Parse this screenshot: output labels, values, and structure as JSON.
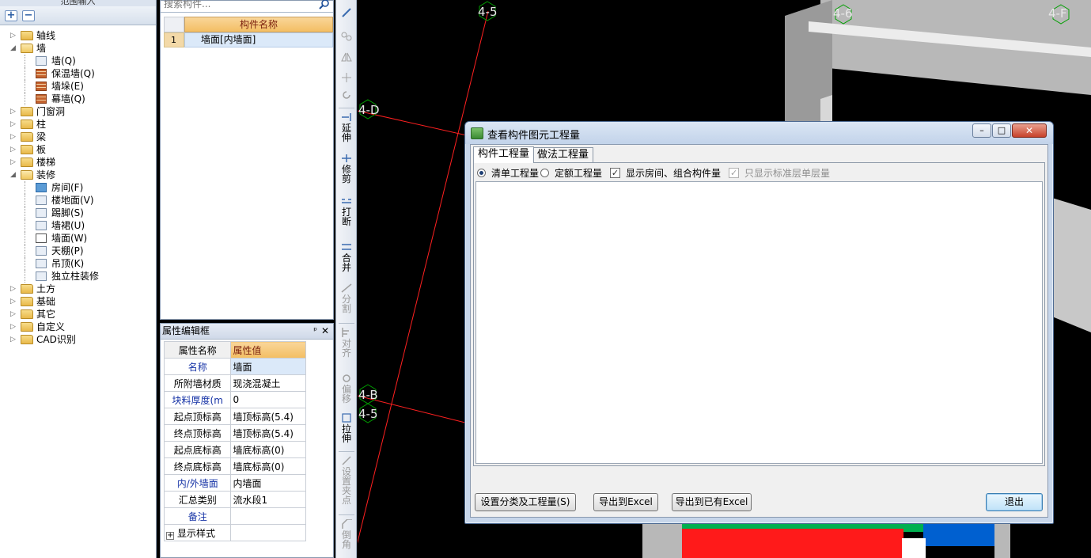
{
  "nav": {
    "title": "范围输入",
    "toolbar": {
      "expand_label": "+",
      "collapse_label": "−"
    },
    "tree": [
      {
        "label": "轴线",
        "level": 0,
        "expanded": false
      },
      {
        "label": "墙",
        "level": 0,
        "expanded": true
      },
      {
        "label": "墙(Q)",
        "level": 1
      },
      {
        "label": "保温墙(Q)",
        "level": 1
      },
      {
        "label": "墙垛(E)",
        "level": 1
      },
      {
        "label": "幕墙(Q)",
        "level": 1
      },
      {
        "label": "门窗洞",
        "level": 0,
        "expanded": false
      },
      {
        "label": "柱",
        "level": 0,
        "expanded": false
      },
      {
        "label": "梁",
        "level": 0,
        "expanded": false
      },
      {
        "label": "板",
        "level": 0,
        "expanded": false
      },
      {
        "label": "楼梯",
        "level": 0,
        "expanded": false
      },
      {
        "label": "装修",
        "level": 0,
        "expanded": true
      },
      {
        "label": "房间(F)",
        "level": 1
      },
      {
        "label": "楼地面(V)",
        "level": 1
      },
      {
        "label": "踢脚(S)",
        "level": 1
      },
      {
        "label": "墙裙(U)",
        "level": 1
      },
      {
        "label": "墙面(W)",
        "level": 1
      },
      {
        "label": "天棚(P)",
        "level": 1
      },
      {
        "label": "吊顶(K)",
        "level": 1
      },
      {
        "label": "独立柱装修",
        "level": 1
      },
      {
        "label": "土方",
        "level": 0,
        "expanded": false
      },
      {
        "label": "基础",
        "level": 0,
        "expanded": false
      },
      {
        "label": "其它",
        "level": 0,
        "expanded": false
      },
      {
        "label": "自定义",
        "level": 0,
        "expanded": false
      },
      {
        "label": "CAD识别",
        "level": 0,
        "expanded": false
      }
    ]
  },
  "component_panel": {
    "search_placeholder": "搜索构件...",
    "column_header": "构件名称",
    "rows": [
      {
        "index": "1",
        "name": "墙面[内墙面]"
      }
    ]
  },
  "property_panel": {
    "title": "属性编辑框",
    "pin_glyph": "ᵖ",
    "close_glyph": "✕",
    "header": {
      "name": "属性名称",
      "value": "属性值"
    },
    "rows": [
      {
        "name": "名称",
        "value": "墙面"
      },
      {
        "name": "所附墙材质",
        "value": "现浇混凝土"
      },
      {
        "name": "块料厚度(m",
        "value": "0"
      },
      {
        "name": "起点顶标高",
        "value": "墙顶标高(5.4)"
      },
      {
        "name": "终点顶标高",
        "value": "墙顶标高(5.4)"
      },
      {
        "name": "起点底标高",
        "value": "墙底标高(0)"
      },
      {
        "name": "终点底标高",
        "value": "墙底标高(0)"
      },
      {
        "name": "内/外墙面",
        "value": "内墙面"
      },
      {
        "name": "汇总类别",
        "value": "流水段1"
      },
      {
        "name": "备注",
        "value": ""
      },
      {
        "name": "显示样式",
        "value": ""
      }
    ],
    "expand_glyph": "+"
  },
  "vertical_toolbar": {
    "items": [
      {
        "label": "延伸",
        "enabled": true
      },
      {
        "label": "修剪",
        "enabled": true
      },
      {
        "label": "打断",
        "enabled": true
      },
      {
        "label": "合并",
        "enabled": true
      },
      {
        "label": "分割",
        "enabled": false
      },
      {
        "label": "对齐",
        "enabled": false
      },
      {
        "label": "偏移",
        "enabled": false
      },
      {
        "label": "拉伸",
        "enabled": true
      },
      {
        "label": "设置夹点",
        "enabled": false
      },
      {
        "label": "倒角",
        "enabled": false
      }
    ]
  },
  "canvas": {
    "axis_labels": [
      "4-5",
      "4-6",
      "4-F",
      "4-D",
      "4-B",
      "4-5"
    ],
    "colors": {
      "axis_line": "#ff2020",
      "wall": "#b4b4b4",
      "floor_red": "#ff1a1a",
      "floor_green": "#00b050",
      "floor_blue": "#0060d0",
      "marker": "#00a000"
    }
  },
  "dialog": {
    "title": "查看构件图元工程量",
    "window_buttons": {
      "minimize": "–",
      "maximize": "□",
      "close": "✕"
    },
    "tabs": [
      {
        "label": "构件工程量",
        "active": true
      },
      {
        "label": "做法工程量",
        "active": false
      }
    ],
    "options": {
      "radio_list": "清单工程量",
      "radio_quota": "定额工程量",
      "check_room": "显示房间、组合构件量",
      "check_standard": "只显示标准层单层量",
      "check_glyph": "✓"
    },
    "buttons": {
      "set_category": "设置分类及工程量(S)",
      "export_excel": "导出到Excel",
      "export_existing_excel": "导出到已有Excel",
      "exit": "退出"
    }
  }
}
